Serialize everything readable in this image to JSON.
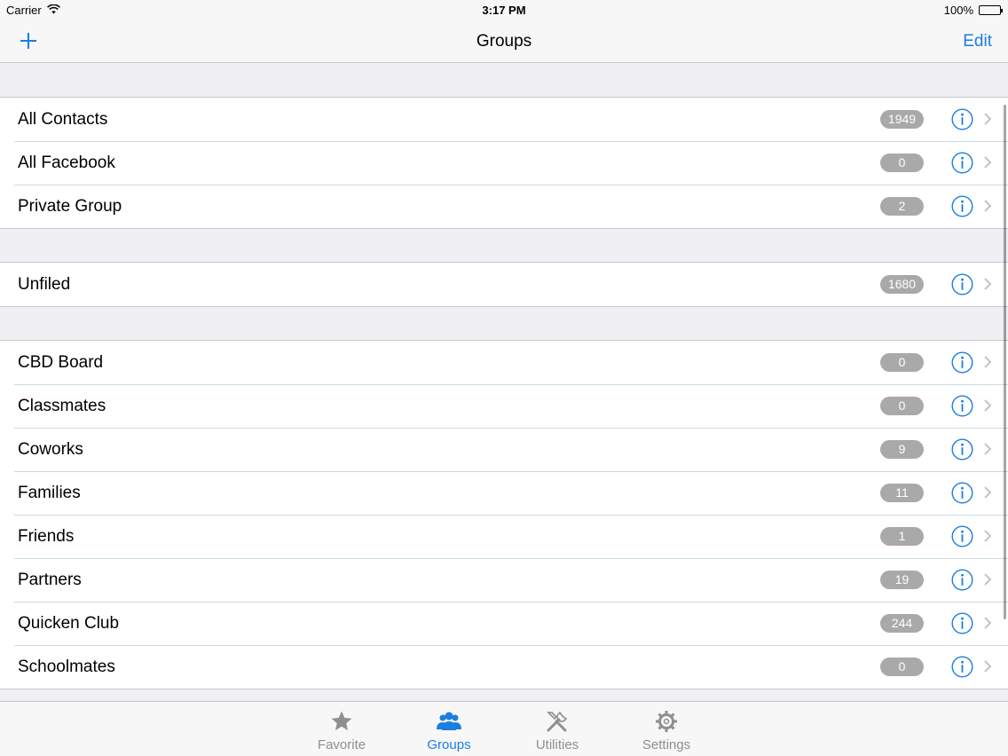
{
  "status_bar": {
    "carrier": "Carrier",
    "time": "3:17 PM",
    "battery": "100%"
  },
  "nav": {
    "title": "Groups",
    "edit_label": "Edit",
    "add_icon": "plus-icon"
  },
  "sections": [
    {
      "rows": [
        {
          "label": "All Contacts",
          "count": "1949"
        },
        {
          "label": "All Facebook",
          "count": "0"
        },
        {
          "label": "Private Group",
          "count": "2"
        }
      ]
    },
    {
      "rows": [
        {
          "label": "Unfiled",
          "count": "1680"
        }
      ]
    },
    {
      "rows": [
        {
          "label": "CBD Board",
          "count": "0"
        },
        {
          "label": "Classmates",
          "count": "0"
        },
        {
          "label": "Coworks",
          "count": "9"
        },
        {
          "label": "Families",
          "count": "11"
        },
        {
          "label": "Friends",
          "count": "1"
        },
        {
          "label": "Partners",
          "count": "19"
        },
        {
          "label": "Quicken Club",
          "count": "244"
        },
        {
          "label": "Schoolmates",
          "count": "0"
        }
      ]
    }
  ],
  "tabs": [
    {
      "label": "Favorite",
      "icon": "star-icon",
      "active": false
    },
    {
      "label": "Groups",
      "icon": "people-icon",
      "active": true
    },
    {
      "label": "Utilities",
      "icon": "tools-icon",
      "active": false
    },
    {
      "label": "Settings",
      "icon": "gear-icon",
      "active": false
    }
  ],
  "colors": {
    "accent": "#1a7ee0",
    "badge": "#a9a9a9",
    "inactive_tab": "#8e8e93"
  }
}
